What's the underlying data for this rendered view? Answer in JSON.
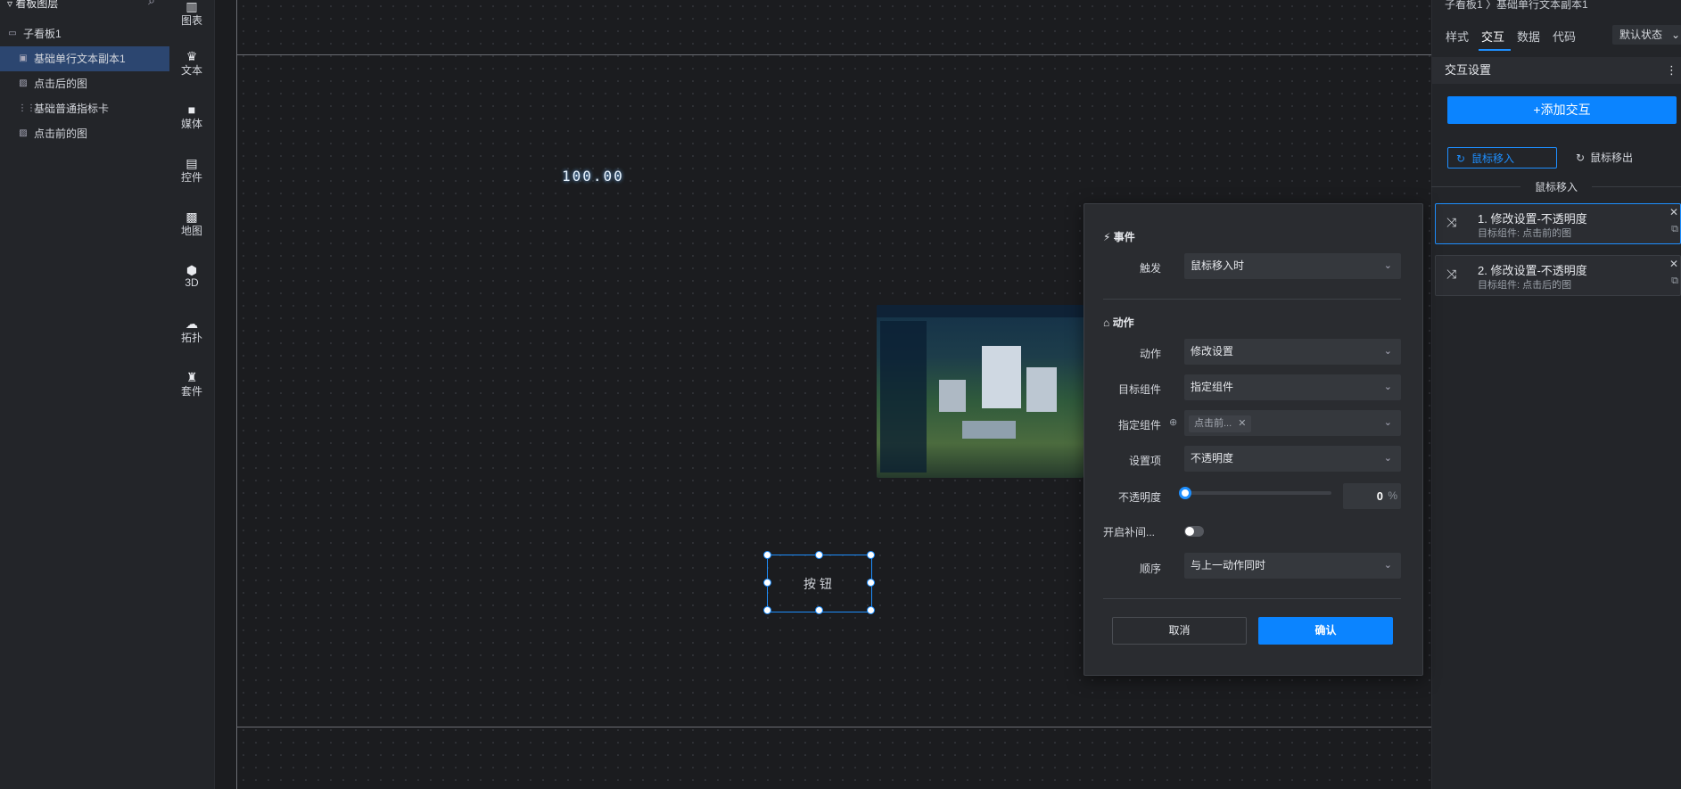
{
  "layers": {
    "title": "看板图层",
    "items": [
      {
        "label": "子看板1",
        "icon": "folder-icon"
      },
      {
        "label": "基础单行文本副本1",
        "icon": "text-icon"
      },
      {
        "label": "点击后的图",
        "icon": "image-icon"
      },
      {
        "label": "基础普通指标卡",
        "icon": "metric-icon"
      },
      {
        "label": "点击前的图",
        "icon": "image-icon"
      }
    ]
  },
  "components": [
    "图表",
    "文本",
    "媒体",
    "控件",
    "地图",
    "3D",
    "拓扑",
    "套件"
  ],
  "canvas": {
    "metric_value": "100.00",
    "button_label": "按钮"
  },
  "right_panel": {
    "breadcrumb": "子看板1 〉基础单行文本副本1",
    "tabs": [
      "样式",
      "交互",
      "数据",
      "代码"
    ],
    "active_tab": "交互",
    "state_select": "默认状态",
    "section_title": "交互设置",
    "add_button": "+添加交互",
    "event_tabs": {
      "in": "鼠标移入",
      "out": "鼠标移出"
    },
    "group_label": "鼠标移入",
    "actions": [
      {
        "title": "1. 修改设置-不透明度",
        "subtitle": "目标组件: 点击前的图"
      },
      {
        "title": "2. 修改设置-不透明度",
        "subtitle": "目标组件: 点击后的图"
      }
    ]
  },
  "dialog": {
    "event_section": "事件",
    "trigger_label": "触发",
    "trigger_value": "鼠标移入时",
    "action_section": "动作",
    "action_label": "动作",
    "action_value": "修改设置",
    "target_label": "目标组件",
    "target_value": "指定组件",
    "specified_label": "指定组件",
    "specified_tag": "点击前...",
    "setting_label": "设置项",
    "setting_value": "不透明度",
    "opacity_label": "不透明度",
    "opacity_value": "0",
    "opacity_unit": "%",
    "tween_label": "开启补间...",
    "order_label": "顺序",
    "order_value": "与上一动作同时",
    "cancel": "取消",
    "confirm": "确认"
  },
  "colors": {
    "accent": "#0b84ff",
    "panel": "#232529",
    "canvas": "#1b1c1f",
    "dialog": "#2a2c30"
  }
}
